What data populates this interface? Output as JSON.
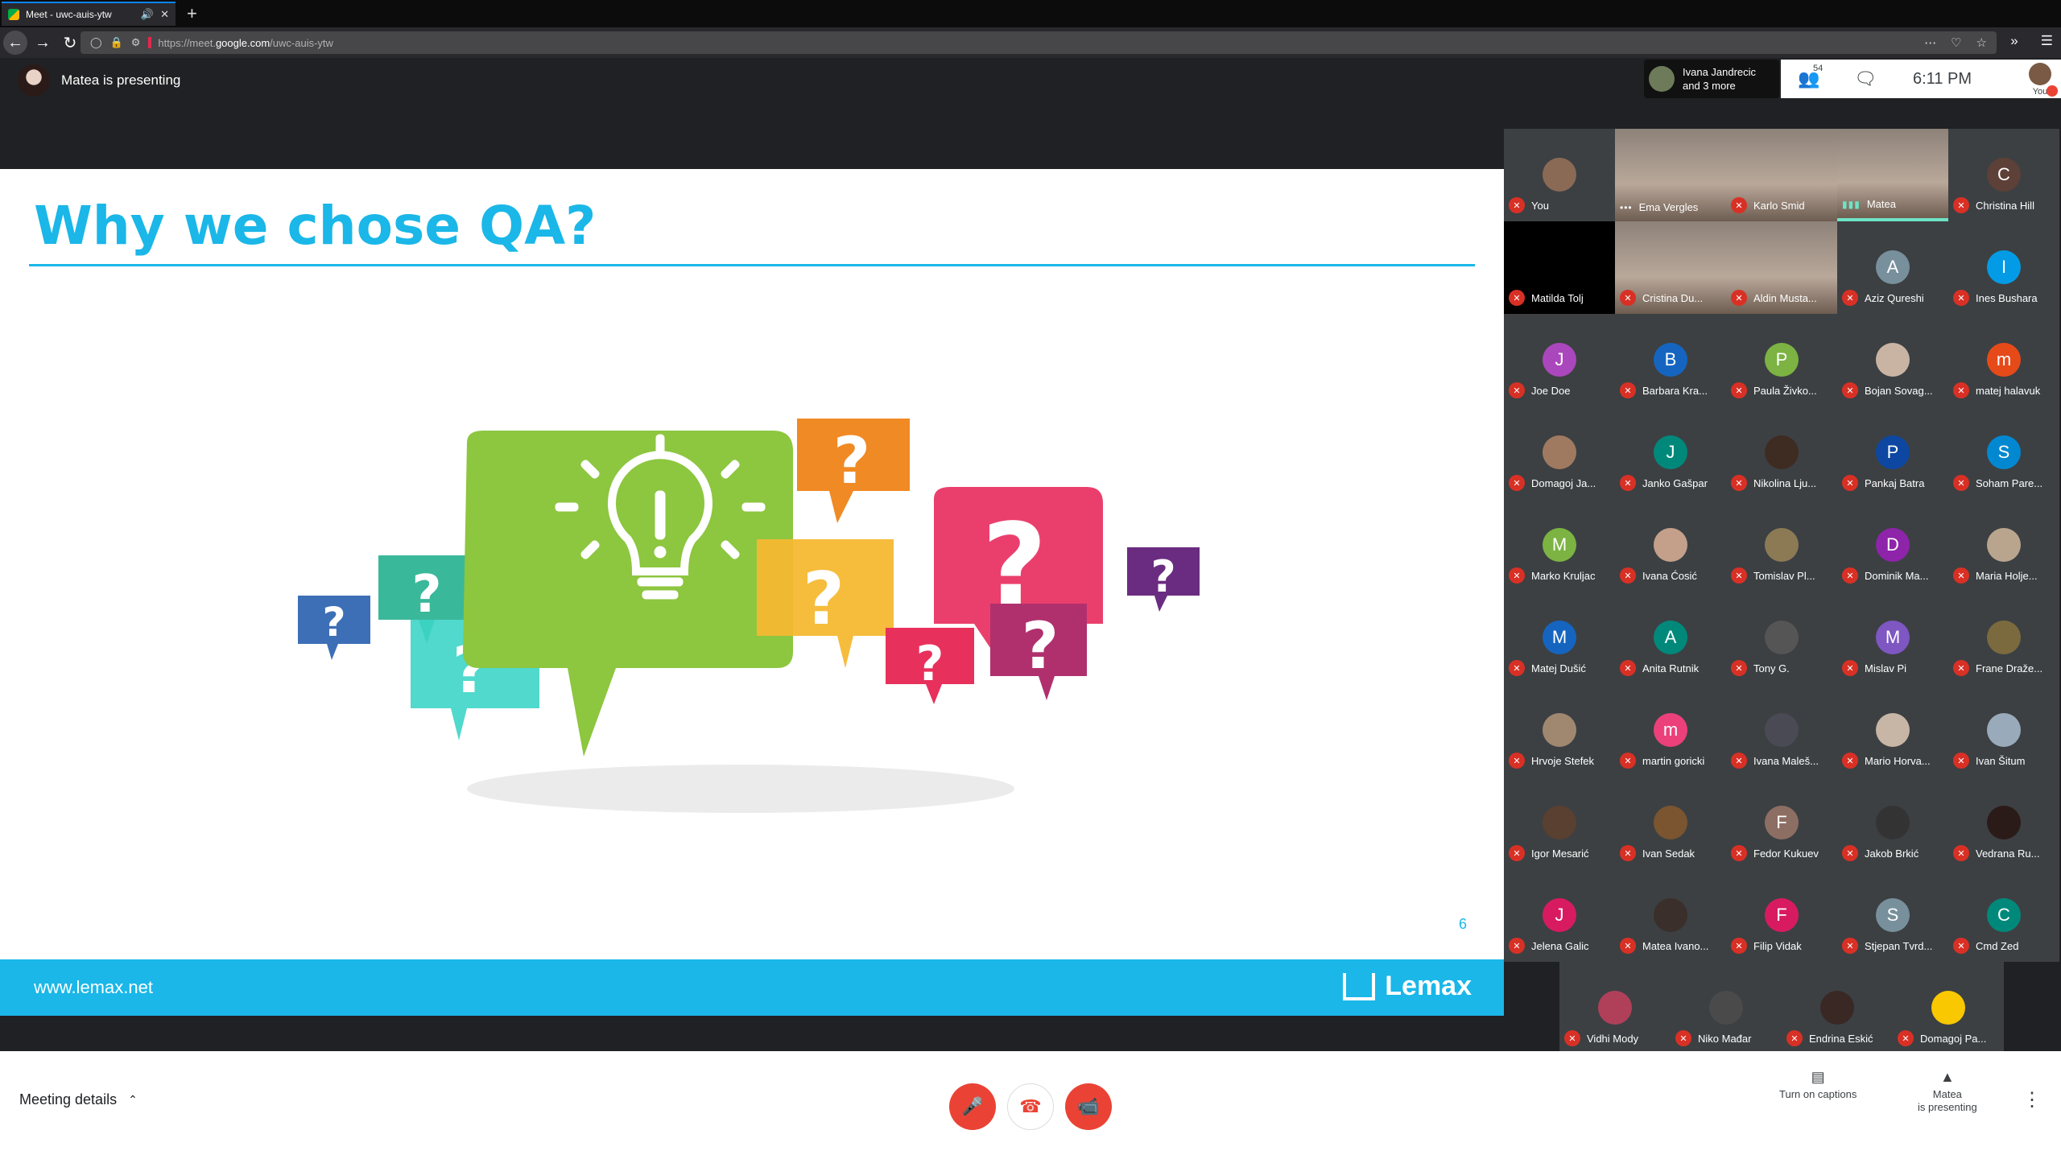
{
  "browser": {
    "tab_title": "Meet - uwc-auis-ytw",
    "url_prefix": "https://meet.",
    "url_domain": "google.com",
    "url_path": "/uwc-auis-ytw"
  },
  "meet": {
    "presenting_label": "Matea is presenting",
    "others_line1": "Ivana Jandrecic",
    "others_line2": "and 3 more",
    "participant_count": "54",
    "time": "6:11 PM",
    "you_label": "You"
  },
  "slide": {
    "title": "Why we chose QA?",
    "page_number": "6",
    "footer_url": "www.lemax.net",
    "logo_text": "Lemax"
  },
  "participants": [
    {
      "name": "You",
      "initial": "",
      "color": "#8a6a55",
      "type": "photo"
    },
    {
      "name": "Ema Vergles",
      "initial": "",
      "color": "",
      "type": "video",
      "state": "dots"
    },
    {
      "name": "Karlo Smid",
      "initial": "",
      "color": "",
      "type": "video"
    },
    {
      "name": "Matea",
      "initial": "",
      "color": "",
      "type": "video",
      "state": "speaking"
    },
    {
      "name": "Christina Hill",
      "initial": "C",
      "color": "#5d4037"
    },
    {
      "name": "Matilda Tolj",
      "initial": "",
      "color": "",
      "type": "dark"
    },
    {
      "name": "Cristina Du...",
      "initial": "",
      "color": "",
      "type": "video"
    },
    {
      "name": "Aldin Musta...",
      "initial": "",
      "color": "",
      "type": "video"
    },
    {
      "name": "Aziz Qureshi",
      "initial": "A",
      "color": "#78909c"
    },
    {
      "name": "Ines Bushara",
      "initial": "I",
      "color": "#039be5"
    },
    {
      "name": "Joe Doe",
      "initial": "J",
      "color": "#ab47bc"
    },
    {
      "name": "Barbara Kra...",
      "initial": "B",
      "color": "#1565c0"
    },
    {
      "name": "Paula Živko...",
      "initial": "P",
      "color": "#7cb342"
    },
    {
      "name": "Bojan Sovag...",
      "initial": "",
      "color": "#c9b4a4",
      "type": "photo"
    },
    {
      "name": "matej halavuk",
      "initial": "m",
      "color": "#e64a19"
    },
    {
      "name": "Domagoj Ja...",
      "initial": "",
      "color": "#a07a60",
      "type": "photo"
    },
    {
      "name": "Janko Gašpar",
      "initial": "J",
      "color": "#00897b"
    },
    {
      "name": "Nikolina Lju...",
      "initial": "",
      "color": "#3e2b22",
      "type": "photo"
    },
    {
      "name": "Pankaj Batra",
      "initial": "P",
      "color": "#0d47a1"
    },
    {
      "name": "Soham Pare...",
      "initial": "S",
      "color": "#0288d1"
    },
    {
      "name": "Marko Kruljac",
      "initial": "M",
      "color": "#7cb342"
    },
    {
      "name": "Ivana Ćosić",
      "initial": "",
      "color": "#c4a08a",
      "type": "photo"
    },
    {
      "name": "Tomislav Pl...",
      "initial": "",
      "color": "#8b7a54",
      "type": "photo"
    },
    {
      "name": "Dominik Ma...",
      "initial": "D",
      "color": "#8e24aa"
    },
    {
      "name": "Maria Holje...",
      "initial": "",
      "color": "#b9a58e",
      "type": "photo"
    },
    {
      "name": "Matej Dušić",
      "initial": "M",
      "color": "#1565c0"
    },
    {
      "name": "Anita Rutnik",
      "initial": "A",
      "color": "#00897b"
    },
    {
      "name": "Tony G.",
      "initial": "",
      "color": "#555",
      "type": "photo"
    },
    {
      "name": "Mislav Pi",
      "initial": "M",
      "color": "#7e57c2"
    },
    {
      "name": "Frane Draže...",
      "initial": "",
      "color": "#7b6a3e",
      "type": "photo"
    },
    {
      "name": "Hrvoje Stefek",
      "initial": "",
      "color": "#a08870",
      "type": "photo"
    },
    {
      "name": "martin goricki",
      "initial": "m",
      "color": "#ec407a"
    },
    {
      "name": "Ivana Maleš...",
      "initial": "",
      "color": "#4a4a55",
      "type": "photo"
    },
    {
      "name": "Mario Horva...",
      "initial": "",
      "color": "#c7b5a5",
      "type": "photo"
    },
    {
      "name": "Ivan Šitum",
      "initial": "",
      "color": "#9ab",
      "type": "photo"
    },
    {
      "name": "Igor Mesarić",
      "initial": "",
      "color": "#5a4030",
      "type": "photo"
    },
    {
      "name": "Ivan Sedak",
      "initial": "",
      "color": "#7a5530",
      "type": "photo"
    },
    {
      "name": "Fedor Kukuev",
      "initial": "F",
      "color": "#8d6e63"
    },
    {
      "name": "Jakob Brkić",
      "initial": "",
      "color": "#333",
      "type": "photo"
    },
    {
      "name": "Vedrana Ru...",
      "initial": "",
      "color": "#2b1b18",
      "type": "photo"
    },
    {
      "name": "Jelena Galic",
      "initial": "J",
      "color": "#d81b60"
    },
    {
      "name": "Matea Ivano...",
      "initial": "",
      "color": "#3a2f2a",
      "type": "photo"
    },
    {
      "name": "Filip Vidak",
      "initial": "F",
      "color": "#d81b60"
    },
    {
      "name": "Stjepan Tvrd...",
      "initial": "S",
      "color": "#78909c"
    },
    {
      "name": "Cmd Zed",
      "initial": "C",
      "color": "#00897b"
    },
    {
      "name": "Vidhi Mody",
      "initial": "",
      "color": "#b0405a",
      "type": "photo"
    },
    {
      "name": "Niko Mađar",
      "initial": "",
      "color": "#4a4a4a",
      "type": "photo"
    },
    {
      "name": "Endrina Eskić",
      "initial": "",
      "color": "#3a2825",
      "type": "photo"
    },
    {
      "name": "Domagoj Pa...",
      "initial": "",
      "color": "#f9c800",
      "type": "photo"
    }
  ],
  "bottom": {
    "meeting_details": "Meeting details",
    "captions_label": "Turn on captions",
    "presenting_line1": "Matea",
    "presenting_line2": "is presenting"
  }
}
